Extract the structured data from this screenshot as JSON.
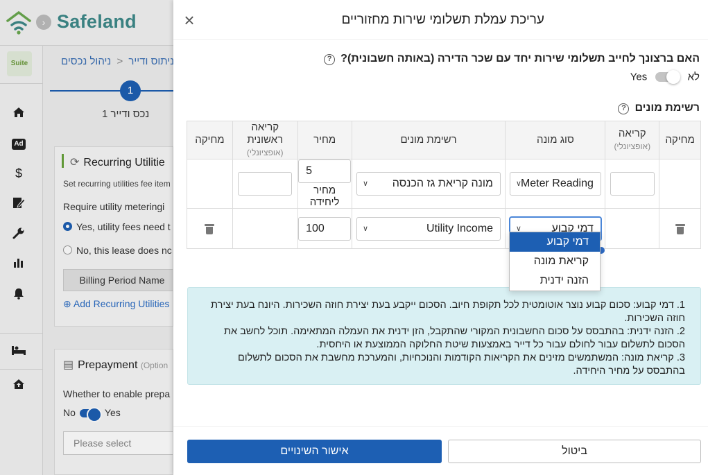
{
  "app": {
    "brand": "Safeland",
    "avatar_text": "Suite"
  },
  "colors": {
    "primary": "#1d5fb3",
    "brand": "#3e8a8a",
    "info_bg": "#d9f0f3"
  },
  "sidebar": {
    "icons": [
      "home-icon",
      "ad-icon",
      "dollar-icon",
      "edit-doc-icon",
      "wrench-icon",
      "bar-chart-icon",
      "bell-icon",
      "bed-icon",
      "house-upload-icon"
    ],
    "ad_label": "Ad"
  },
  "background": {
    "breadcrumb": {
      "part1": "ניהול נכסים",
      "sep": "<",
      "part2": "ניתוס ודייר"
    },
    "step": {
      "number": "1",
      "label": "1 נכס ודייר"
    },
    "recurring_card": {
      "title": "Recurring Utilitie",
      "subtitle": "Set recurring utilities fee item",
      "question": "Require utility meteringi",
      "option_yes": "Yes, utility fees need t",
      "option_no": "No, this lease does nc",
      "billing_button": "Billing Period Name",
      "add_link": "Add Recurring Utilities"
    },
    "prepayment_card": {
      "title": "Prepayment",
      "optional": "(Option",
      "question": "Whether to enable prepa",
      "no": "No",
      "yes": "Yes",
      "select_placeholder": "Please select"
    }
  },
  "drawer": {
    "title": "עריכת עמלת תשלומי שירות מחזוריים",
    "question": "האם ברצונך לחייב תשלומי שירות יחד עם שכר הדירה (באותה חשבונית)?",
    "toggle": {
      "off_label": "לא",
      "on_label": "Yes",
      "enabled": false
    },
    "meters_section": "רשימת מונים",
    "table": {
      "headers": {
        "delete": "מחיקה",
        "reading": "קריאה",
        "reading_opt": "(אופציונלי)",
        "meter_type": "סוג מונה",
        "meter_list": "רשימת מונים",
        "price": "מחיר",
        "first_reading": "קריאה ראשונית",
        "first_reading_opt": "(אופציונלי)",
        "delete2": "מחיקה"
      },
      "rows": [
        {
          "reading": "",
          "meter_type": "Meter Reading",
          "meter_list": "מונה קריאת גז הכנסה",
          "price": "5",
          "price_unit": "מחיר ליחידה",
          "first_reading": ""
        },
        {
          "reading": "",
          "meter_type": "דמי קבוע",
          "meter_list": "Utility Income",
          "price": "100",
          "price_unit": "",
          "first_reading": ""
        }
      ]
    },
    "dropdown_options": [
      "דמי קבוע",
      "קריאת מונה",
      "הזנה ידנית"
    ],
    "dropdown_selected": "דמי קבוע",
    "info": [
      "1. דמי קבוע: סכום קבוע נוצר אוטומטית לכל תקופת חיוב. הסכום ייקבע בעת יצירת חוזה השכירות. היונח בעת יצירת חוזה השכירות.",
      "2. הזנה ידנית: בהתבסס על סכום החשבונית המקורי שהתקבל, הזן ידנית את העמלה המתאימה. תוכל לחשב את הסכום לתשלום עבור לחולם עבור כל דייר באמצעות שיטת החלוקה הממוצעת או היחסית.",
      "3. קריאת מונה: המשתמשים מזינים את הקריאות הקודמות והנוכחיות, והמערכת מחשבת את הסכום לתשלום בהתבסס על מחיר היחידה."
    ],
    "buttons": {
      "confirm": "אישור השינויים",
      "cancel": "ביטול"
    }
  }
}
